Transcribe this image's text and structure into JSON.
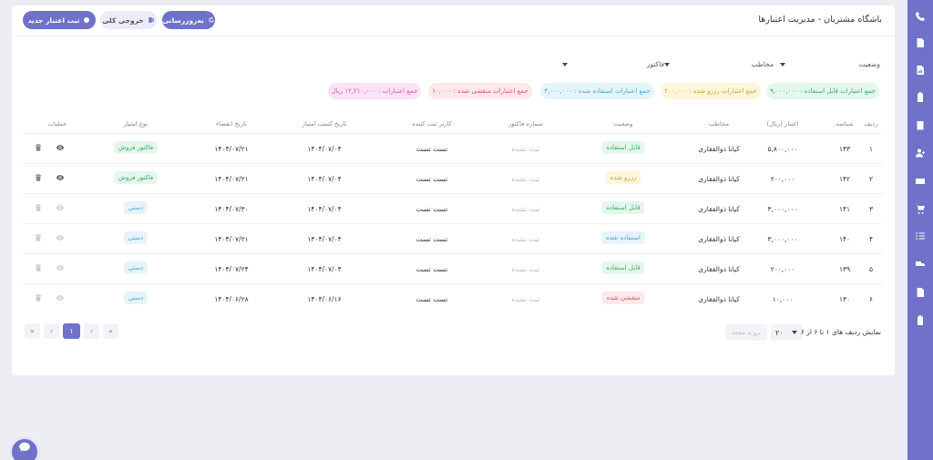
{
  "header": {
    "title": "باشگاه مشتریان - مدیریت اعتبارها",
    "refresh_label": "بەروزرسانی",
    "export_label": "خروجی کلی",
    "new_label": "ثبت اعتبار جدید"
  },
  "filters": {
    "status": "وضعیت",
    "contact": "مخاطب",
    "invoice": "فاکتور"
  },
  "summary": {
    "usable": "جمع اعتبارات قابل استفاده : ۹,۰۰۰,۰۰۰",
    "reserved": "جمع اعتبارات رزرو شده : ۲۰۰,۰۰۰",
    "used": "جمع اعتبارات استفاده شده : ۳,۰۰۰,۰۰۰",
    "expired": "جمع اعتبارات منقضی شده : ۱۰,۰۰۰",
    "total": "جمع اعتبارات : ۱۲,۲۱۰,۰۰۰ ریال"
  },
  "table": {
    "columns": {
      "row": "ردیف",
      "id": "شناسه",
      "amount": "اعتبار (ریال)",
      "contact": "مخاطب",
      "status": "وضعیت",
      "invoice": "شماره فاکتور",
      "creator": "کاربر ثبت کننده",
      "earn_date": "تاریخ کسب امتیاز",
      "expire_date": "تاریخ انقضاء",
      "type": "نوع امتیاز",
      "ops": "عملیات"
    },
    "rows": [
      {
        "row": "۱",
        "id": "۱۴۳",
        "amount": "۵,۸۰۰,۰۰۰",
        "contact": "کیانا ذوالفقاری",
        "status": "قابل استفاده",
        "status_color": "green",
        "invoice": "ثبت نشده",
        "creator": "تست تست",
        "earn_date": "۱۴۰۴/۰۷/۰۴",
        "expire_date": "۱۴۰۴/۰۷/۲۱",
        "type": "فاکتور فروش",
        "type_color": "green",
        "ops_active": true
      },
      {
        "row": "۲",
        "id": "۱۴۲",
        "amount": "۲۰۰,۰۰۰",
        "contact": "کیانا ذوالفقاری",
        "status": "رزرو شده",
        "status_color": "yellow",
        "invoice": "ثبت نشده",
        "creator": "تست تست",
        "earn_date": "۱۴۰۴/۰۷/۰۴",
        "expire_date": "۱۴۰۴/۰۷/۲۱",
        "type": "فاکتور فروش",
        "type_color": "green",
        "ops_active": true
      },
      {
        "row": "۳",
        "id": "۱۴۱",
        "amount": "۳,۰۰۰,۰۰۰",
        "contact": "کیانا ذوالفقاری",
        "status": "قابل استفاده",
        "status_color": "green",
        "invoice": "ثبت نشده",
        "creator": "تست تست",
        "earn_date": "۱۴۰۴/۰۷/۰۴",
        "expire_date": "۱۴۰۴/۰۷/۳۰",
        "type": "دستی",
        "type_color": "blue",
        "ops_active": false
      },
      {
        "row": "۴",
        "id": "۱۴۰",
        "amount": "۳,۰۰۰,۰۰۰",
        "contact": "کیانا ذوالفقاری",
        "status": "استفاده شده",
        "status_color": "blue",
        "invoice": "ثبت نشده",
        "creator": "تست تست",
        "earn_date": "۱۴۰۴/۰۷/۰۴",
        "expire_date": "۱۴۰۴/۰۷/۲۱",
        "type": "دستی",
        "type_color": "blue",
        "ops_active": false
      },
      {
        "row": "۵",
        "id": "۱۳۹",
        "amount": "۲۰۰,۰۰۰",
        "contact": "کیانا ذوالفقاری",
        "status": "قابل استفاده",
        "status_color": "green",
        "invoice": "ثبت نشده",
        "creator": "تست تست",
        "earn_date": "۱۴۰۴/۰۷/۰۴",
        "expire_date": "۱۴۰۴/۰۷/۲۴",
        "type": "دستی",
        "type_color": "blue",
        "ops_active": false
      },
      {
        "row": "۶",
        "id": "۱۳۰",
        "amount": "۱۰,۰۰۰",
        "contact": "کیانا ذوالفقاری",
        "status": "منقضی شده",
        "status_color": "red",
        "invoice": "ثبت نشده",
        "creator": "تست تست",
        "earn_date": "۱۴۰۴/۰۶/۱۶",
        "expire_date": "۱۴۰۴/۰۶/۲۸",
        "type": "دستی",
        "type_color": "blue",
        "ops_active": false
      }
    ]
  },
  "pagination": {
    "info": "نمایش ردیف های ۱ تا ۶ از ۶",
    "page_size": "۲۰",
    "goto_placeholder": "برو به صفحه",
    "current_page": "۱",
    "first": "«",
    "prev": "‹",
    "next": "›",
    "last": "»"
  }
}
